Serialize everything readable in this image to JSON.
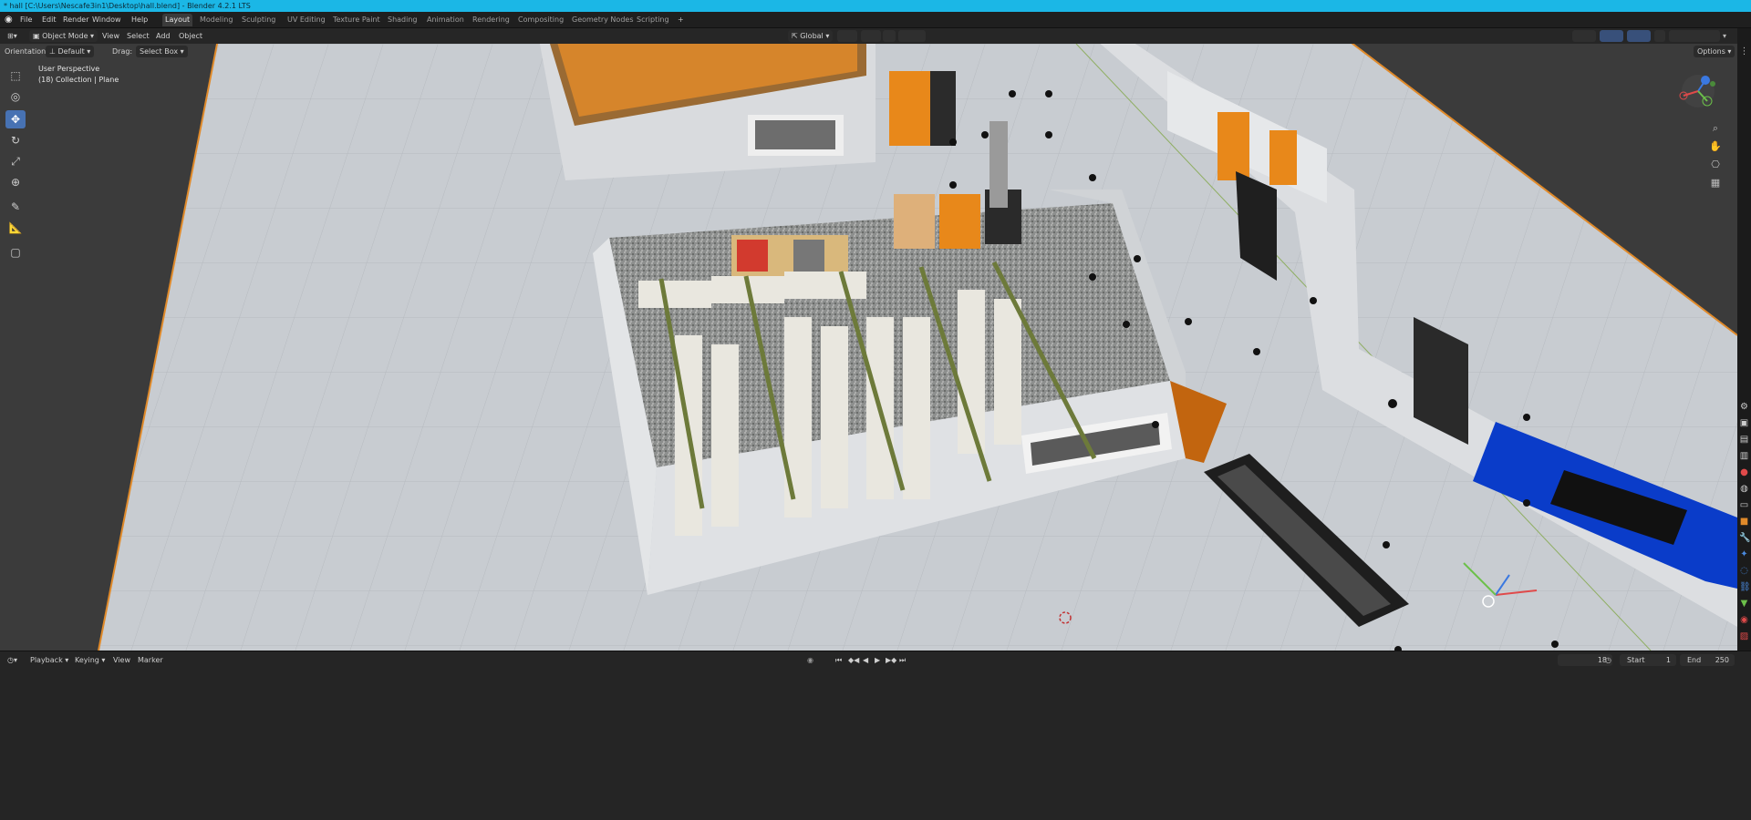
{
  "window": {
    "title": "* hall [C:\\Users\\Nescafe3in1\\Desktop\\hall.blend] - Blender 4.2.1 LTS"
  },
  "menubar": {
    "items": [
      "File",
      "Edit",
      "Render",
      "Window",
      "Help"
    ],
    "workspaces": [
      "Layout",
      "Modeling",
      "Sculpting",
      "UV Editing",
      "Texture Paint",
      "Shading",
      "Animation",
      "Rendering",
      "Compositing",
      "Geometry Nodes",
      "Scripting"
    ],
    "active_workspace": "Layout",
    "add_workspace": "+"
  },
  "viewport_header": {
    "mode": "Object Mode",
    "menus": [
      "View",
      "Select",
      "Add",
      "Object"
    ],
    "transform_orientation": "Global",
    "options_label": "Options"
  },
  "tool_settings": {
    "orientation_label": "Orientation:",
    "orientation_value": "Default",
    "drag_label": "Drag:",
    "drag_value": "Select Box"
  },
  "viewport": {
    "view_name": "User Perspective",
    "collection_info": "(18) Collection | Plane"
  },
  "timeline": {
    "menus": [
      "Playback",
      "Keying",
      "View",
      "Marker"
    ],
    "current_frame": "18",
    "start_label": "Start",
    "start_value": "1",
    "end_label": "End",
    "end_value": "250"
  },
  "colors": {
    "accent_blue": "#4772b3",
    "title_bar": "#1bb7e6",
    "floor": "#c7cbd0",
    "wall": "#d7d9dc",
    "door_orange": "#e8881a",
    "blue_object": "#0a3cc9"
  },
  "icons": {
    "blender_logo": "blender-logo-icon",
    "toolbar": [
      "select-box-icon",
      "cursor-icon",
      "move-icon",
      "rotate-icon",
      "scale-icon",
      "transform-icon",
      "annotate-icon",
      "measure-icon",
      "add-cube-icon"
    ],
    "navigation": [
      "zoom-icon",
      "hand-pan-icon",
      "camera-view-icon",
      "grid-view-icon"
    ]
  }
}
